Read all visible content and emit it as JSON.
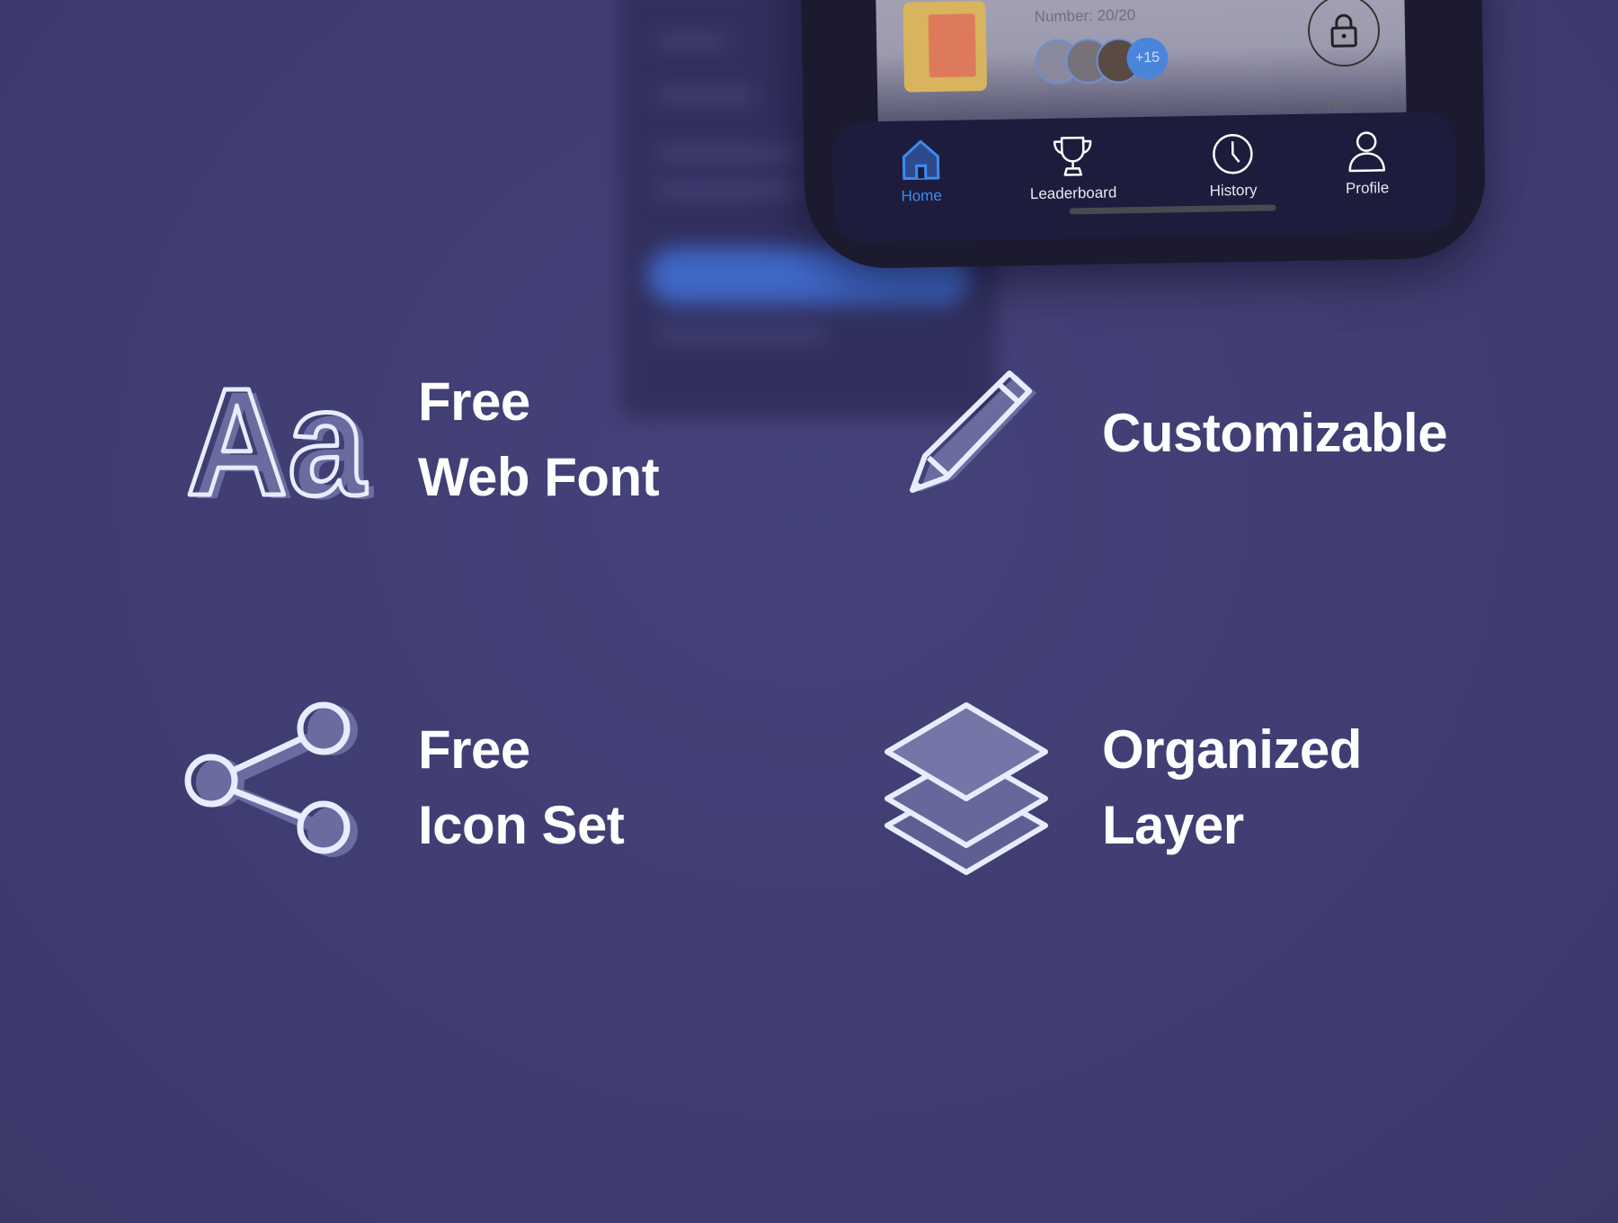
{
  "colors": {
    "background": "#403d72",
    "accent": "#3d8bf0",
    "icon_outline": "#e8ecff",
    "icon_fill": "#6a6ca0"
  },
  "phone": {
    "card": {
      "number_text": "Number: 20/20",
      "extra_count": "+15",
      "progress_text": "0%"
    },
    "nav": [
      {
        "label": "Home",
        "icon": "home-icon",
        "active": true
      },
      {
        "label": "Leaderboard",
        "icon": "trophy-icon",
        "active": false
      },
      {
        "label": "History",
        "icon": "clock-icon",
        "active": false
      },
      {
        "label": "Profile",
        "icon": "user-icon",
        "active": false
      }
    ]
  },
  "features": [
    {
      "icon": "font-icon",
      "glyph": "Aa",
      "lines": [
        "Free",
        "Web Font"
      ]
    },
    {
      "icon": "pencil-icon",
      "lines": [
        "Customizable"
      ]
    },
    {
      "icon": "share-icon",
      "lines": [
        "Free",
        "Icon Set"
      ]
    },
    {
      "icon": "layers-icon",
      "lines": [
        "Organized",
        "Layer"
      ]
    }
  ]
}
